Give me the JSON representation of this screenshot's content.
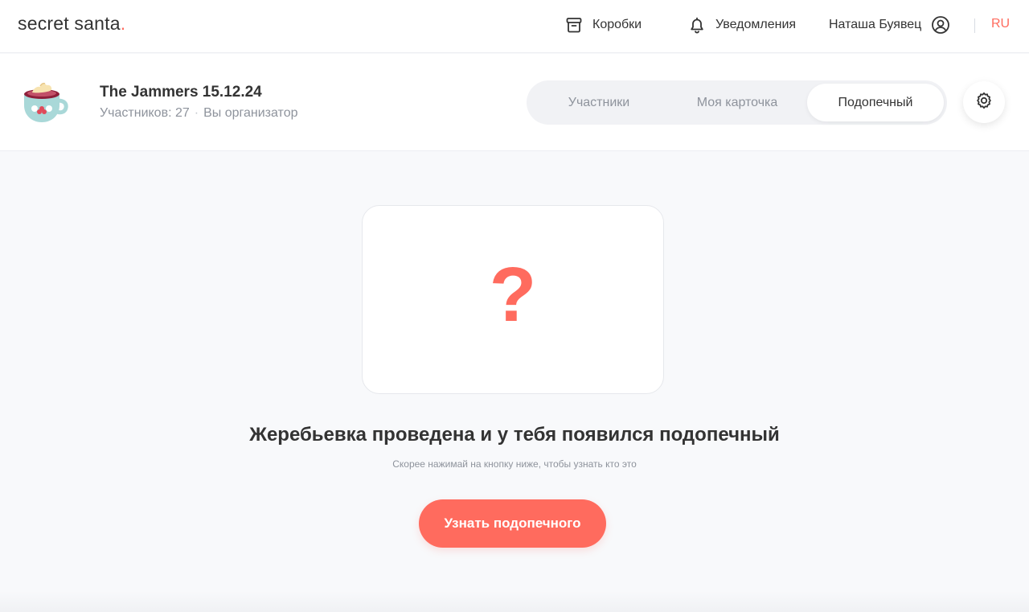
{
  "header": {
    "logo_text": "secret santa",
    "logo_dot": ".",
    "nav": {
      "boxes_label": "Коробки",
      "notifications_label": "Уведомления",
      "user_name": "Наташа Буявец",
      "lang": "RU"
    }
  },
  "box": {
    "title": "The Jammers 15.12.24",
    "participants_text": "Участников: 27",
    "meta_sep": "·",
    "role_text": "Вы организатор",
    "tabs": [
      {
        "label": "Участники"
      },
      {
        "label": "Моя карточка"
      },
      {
        "label": "Подопечный",
        "active": true
      }
    ]
  },
  "main": {
    "card_symbol": "?",
    "headline": "Жеребьевка проведена и у тебя появился подопечный",
    "subline": "Скорее нажимай на кнопку ниже, чтобы узнать кто это",
    "cta_label": "Узнать подопечного"
  },
  "colors": {
    "accent": "#ff6b5e",
    "text": "#333333",
    "muted": "#8e939c",
    "background": "#f8f9fb"
  },
  "icons": {
    "boxes": "box-archive-icon",
    "notifications": "bell-icon",
    "user": "user-circle-icon",
    "settings": "gear-icon",
    "box_avatar": "teacup-icon"
  }
}
